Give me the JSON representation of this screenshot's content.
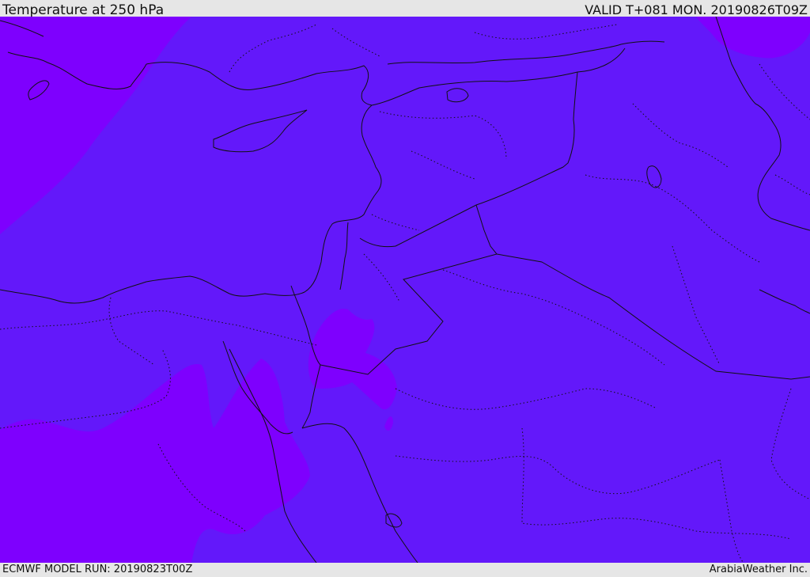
{
  "header": {
    "title": "Temperature at 250 hPa",
    "valid": "VALID T+081 MON. 20190826T09Z"
  },
  "footer": {
    "model_run": "ECMWF MODEL RUN: 20190823T00Z",
    "credit": "ArabiaWeather Inc."
  },
  "colors": {
    "field_main": "#6318fa",
    "field_warm": "#7e00fe",
    "coastline": "#111111"
  }
}
